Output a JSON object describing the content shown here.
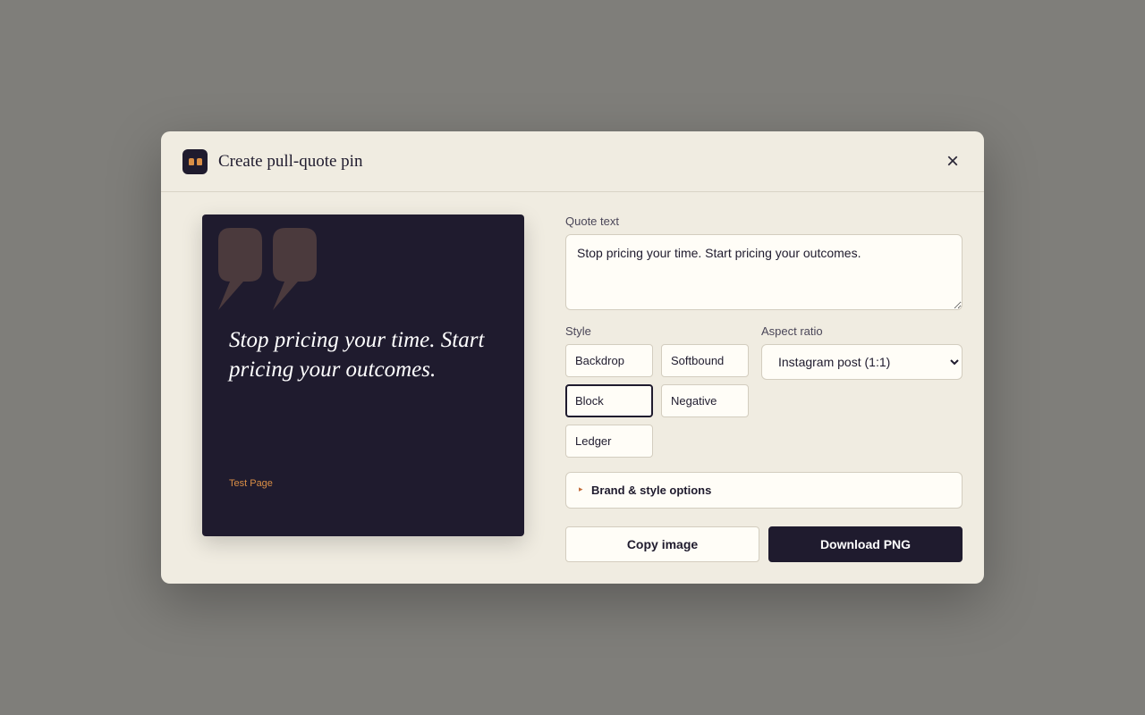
{
  "header": {
    "title": "Create pull-quote pin",
    "close_icon": "×",
    "logo_icon": "quote-logo-icon"
  },
  "preview": {
    "quote": "Stop pricing your time. Start pricing your outcomes.",
    "brand": "Test Page",
    "background_color": "#1f1b2e",
    "accent_color": "#d98e46",
    "quote_mark_color": "#4b3a3d"
  },
  "form": {
    "quote_label": "Quote text",
    "quote_value": "Stop pricing your time. Start pricing your outcomes.",
    "style_label": "Style",
    "styles": [
      "Backdrop",
      "Softbound",
      "Block",
      "Negative",
      "Ledger"
    ],
    "selected_style": "Block",
    "aspect_label": "Aspect ratio",
    "aspect_value": "Instagram post (1:1)",
    "options_label": "Brand & style options",
    "options_caret": "▸"
  },
  "actions": {
    "copy_label": "Copy image",
    "download_label": "Download PNG"
  }
}
